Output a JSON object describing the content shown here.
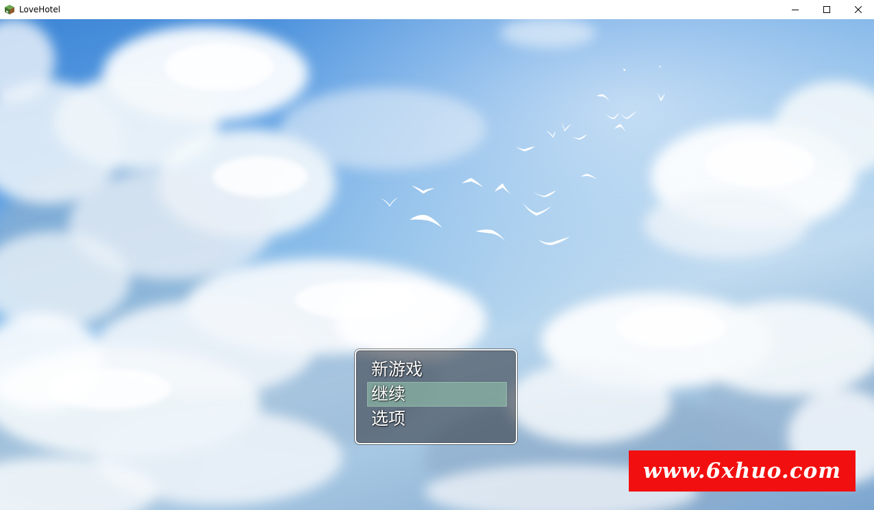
{
  "window": {
    "title": "LoveHotel",
    "icon": "game-app-icon",
    "controls": [
      "minimize-icon",
      "maximize-icon",
      "close-icon"
    ]
  },
  "background": {
    "scene": "sky-with-clouds-and-birds"
  },
  "menu": {
    "items": [
      {
        "label": "新游戏",
        "selected": false
      },
      {
        "label": "继续",
        "selected": true
      },
      {
        "label": "选项",
        "selected": false
      }
    ]
  },
  "watermark": {
    "text": "www.6xhuo.com",
    "color": "#f20f0f"
  }
}
